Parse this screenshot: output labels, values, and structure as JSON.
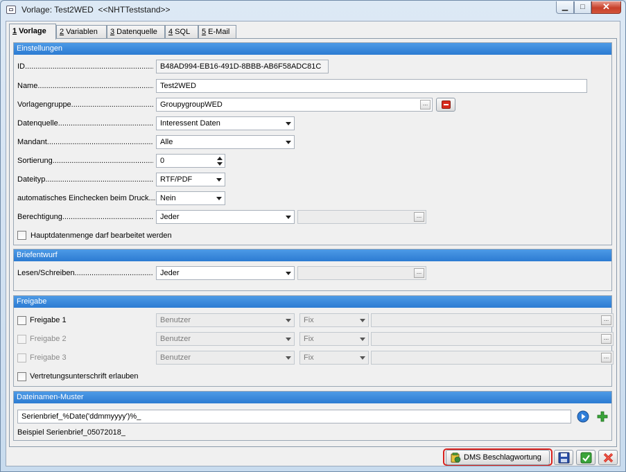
{
  "window": {
    "title": "Vorlage: Test2WED  <<NHTTeststand>>",
    "min_glyph": "▁",
    "max_glyph": "□",
    "close_glyph": "✕"
  },
  "tabs": [
    {
      "key": "1",
      "label": " Vorlage"
    },
    {
      "key": "2",
      "label": " Variablen"
    },
    {
      "key": "3",
      "label": " Datenquelle"
    },
    {
      "key": "4",
      "label": " SQL"
    },
    {
      "key": "5",
      "label": " E-Mail"
    }
  ],
  "einstellungen": {
    "header": "Einstellungen",
    "id_label": "ID...............................................................................",
    "id_value": "B48AD994-EB16-491D-8BBB-AB6F58ADC81C",
    "name_label": "Name.............................................................................",
    "name_value": "Test2WED",
    "vorlagengruppe_label": "Vorlagengruppe..................................................................",
    "vorlagengruppe_value": "GroupygroupWED",
    "datenquelle_label": "Datenquelle......................................................................",
    "datenquelle_value": "Interessent Daten",
    "mandant_label": "Mandant...........................................................................",
    "mandant_value": "Alle",
    "sortierung_label": "Sortierung........................................................................",
    "sortierung_value": "0",
    "dateityp_label": "Dateityp............................................................................",
    "dateityp_value": "RTF/PDF",
    "einchecken_label": "automatisches Einchecken beim Druck.........",
    "einchecken_value": "Nein",
    "berechtigung_label": "Berechtigung....................................................................",
    "berechtigung_value": "Jeder",
    "hauptdaten_label": "Hauptdatenmenge darf bearbeitet werden"
  },
  "briefentwurf": {
    "header": "Briefentwurf",
    "lesen_label": "Lesen/Schreiben..............................................................",
    "lesen_value": "Jeder"
  },
  "freigabe": {
    "header": "Freigabe",
    "rows": [
      {
        "label": "Freigabe 1",
        "user": "Benutzer",
        "mode": "Fix"
      },
      {
        "label": "Freigabe 2",
        "user": "Benutzer",
        "mode": "Fix"
      },
      {
        "label": "Freigabe 3",
        "user": "Benutzer",
        "mode": "Fix"
      }
    ],
    "vertretung_label": "Vertretungsunterschrift erlauben"
  },
  "dateinamen": {
    "header": "Dateinamen-Muster",
    "value": "Serienbrief_%Date('ddmmyyyy')%_",
    "example": "Beispiel Serienbrief_05072018_"
  },
  "footer": {
    "dms_label": "DMS Beschlagwortung"
  },
  "colors": {
    "header_blue": "#2c7bd2",
    "highlight_red": "#d8201c",
    "ok_green": "#3aa43a",
    "cancel_red": "#d42a1e"
  }
}
